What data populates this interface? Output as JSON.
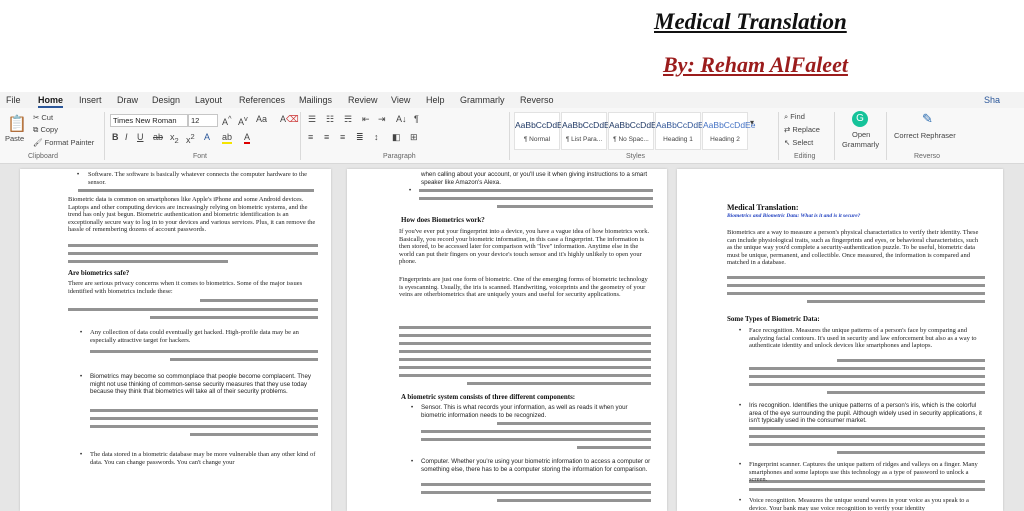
{
  "banner": {
    "title": "Medical Translation",
    "author": "By: Reham AlFaleet"
  },
  "menu": {
    "items": [
      "File",
      "Home",
      "Insert",
      "Draw",
      "Design",
      "Layout",
      "References",
      "Mailings",
      "Review",
      "View",
      "Help",
      "Grammarly",
      "Reverso"
    ],
    "share": "Sha"
  },
  "ribbon": {
    "clipboard": {
      "paste": "Paste",
      "cut": "Cut",
      "copy": "Copy",
      "format_painter": "Format Painter",
      "label": "Clipboard"
    },
    "font": {
      "name": "Times New Roman",
      "size": "12",
      "label": "Font"
    },
    "paragraph": {
      "label": "Paragraph"
    },
    "styles": {
      "label": "Styles",
      "items": [
        {
          "preview": "AaBbCcDdEe",
          "name": "¶ Normal"
        },
        {
          "preview": "AaBbCcDdEe",
          "name": "¶ List Para..."
        },
        {
          "preview": "AaBbCcDdEe",
          "name": "¶ No Spac..."
        },
        {
          "preview": "AaBbCcDdEe",
          "name": "Heading 1"
        },
        {
          "preview": "AaBbCcDdEe",
          "name": "Heading 2"
        }
      ]
    },
    "editing": {
      "find": "Find",
      "replace": "Replace",
      "select": "Select",
      "label": "Editing"
    },
    "grammarly": {
      "open": "Open",
      "name": "Grammarly",
      "label": ""
    },
    "reverso": {
      "correct": "Correct",
      "rephraser": "Rephraser",
      "label": "Reverso"
    }
  },
  "pages": {
    "p1": {
      "software": "Software. The software is basically whatever connects the computer hardware to the sensor.",
      "intro": "Biometric data is common on smartphones like Apple's iPhone and some Android devices. Laptops and other computing devices are increasingly relying on biometric systems, and the trend has only just begun. Biometric authentication and biometric identification is an exceptionally secure way to log in to your devices and various services. Plus, it can remove the hassle of remembering dozens of account passwords.",
      "safe_head": "Are biometrics safe?",
      "safe_intro": "There are serious privacy concerns when it comes to biometrics. Some of the major issues identified with biometrics include these:",
      "b1": "Any collection of data could eventually get hacked. High-profile data may be an especially attractive target for hackers.",
      "b2": "Biometrics may become so commonplace that people become complacent. They might not use thinking of common-sense security measures that they use today because they think that biometrics will take all of their security problems.",
      "b3": "The data stored in a biometric database may be more vulnerable than any other kind of data. You can change passwords. You can't change your"
    },
    "p2": {
      "top": "when calling about your account, or you'll use it when giving instructions to a smart speaker like Amazon's Alexa.",
      "how_head": "How does Biometrics work?",
      "how": "If you've ever put your fingerprint into a device, you have a vague idea of how biometrics work. Basically, you record your biometric information, in this case a fingerprint. The information is then stored, to be accessed later for comparison with \"live\" information. Anytime else in the world can put their fingers on your device's touch sensor and it's highly unlikely to open your phone.",
      "fp": "Fingerprints are just one form of biometric. One of the emerging forms of biometric technology is eyescanning. Usually, the iris is scanned. Handwriting, voiceprints and the geometry of your veins are otherbiometrics that are uniquely yours and useful for security applications.",
      "comp_head": "A biometric system consists of three different components:",
      "sensor": "Sensor. This is what records your information, as well as reads it when your biometric information needs to be recognized.",
      "computer": "Computer. Whether you're using your biometric information to access a computer or something else, there has to be a computer storing the information for comparison."
    },
    "p3": {
      "head": "Medical Translation:",
      "sub": "Biometrics and Biometric Data: What is it and is it secure?",
      "intro": "Biometrics are a way to measure a person's physical characteristics to verify their identity. These can include physiological traits, such as fingerprints and eyes, or behavioral characteristics, such as the unique way you'd complete a security-authentication puzzle. To be useful, biometric data must be unique, permanent, and collectible. Once measured, the information is compared and matched in a database.",
      "types_head": "Some Types of Biometric Data:",
      "face": "Face recognition. Measures the unique patterns of a person's face by comparing and analyzing facial contours. It's used in security and law enforcement but also as a way to authenticate identity and unlock devices like smartphones and laptops.",
      "iris": "Iris recognition. Identifies the unique patterns of a person's iris, which is the colorful area of the eye surrounding the pupil. Although widely used in security applications, it isn't typically used in the consumer market.",
      "finger": "Fingerprint scanner. Captures the unique pattern of ridges and valleys on a finger. Many smartphones and some laptops use this technology as a type of password to unlock a screen.",
      "voice": "Voice recognition. Measures the unique sound waves in your voice as you speak to a device. Your bank may use voice recognition to verify your identity"
    }
  }
}
